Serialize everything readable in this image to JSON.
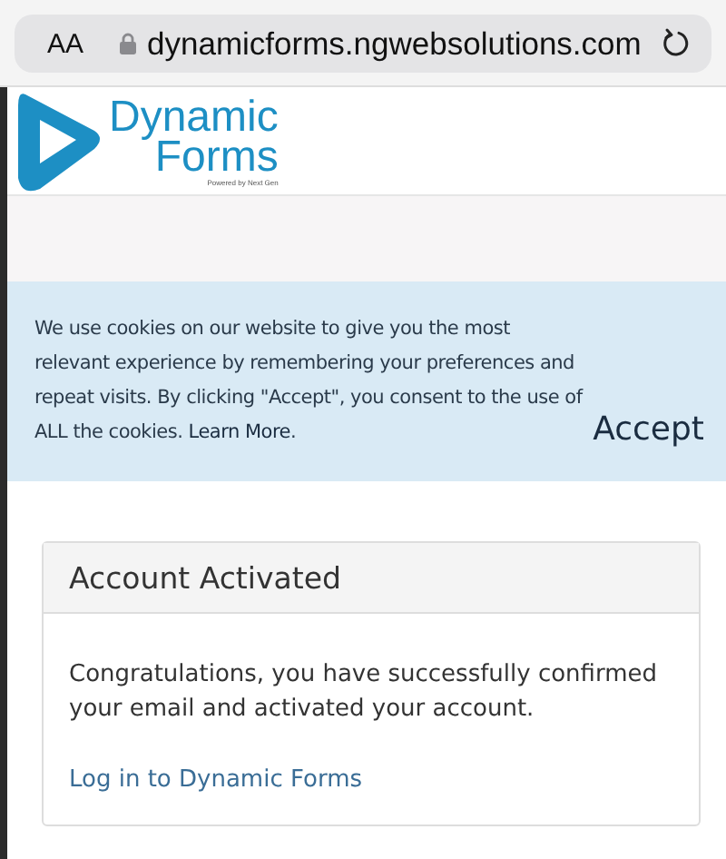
{
  "browser": {
    "text_size": "AA",
    "url": "dynamicforms.ngwebsolutions.com"
  },
  "logo": {
    "line_1": "Dynamic",
    "line_2": "Forms",
    "tagline": "Powered by Next Gen"
  },
  "cookie_banner": {
    "text": "We use cookies on our website to give you the most relevant experience by remembering your preferences and repeat visits. By clicking \"Accept\", you consent to the use of ALL the cookies.",
    "link": "Learn More",
    "after_link": ".",
    "button": "Accept"
  },
  "card": {
    "title": "Account Activated",
    "message": "Congratulations, you have successfully confirmed your email and activated your account.",
    "link": "Log in to Dynamic Forms"
  }
}
